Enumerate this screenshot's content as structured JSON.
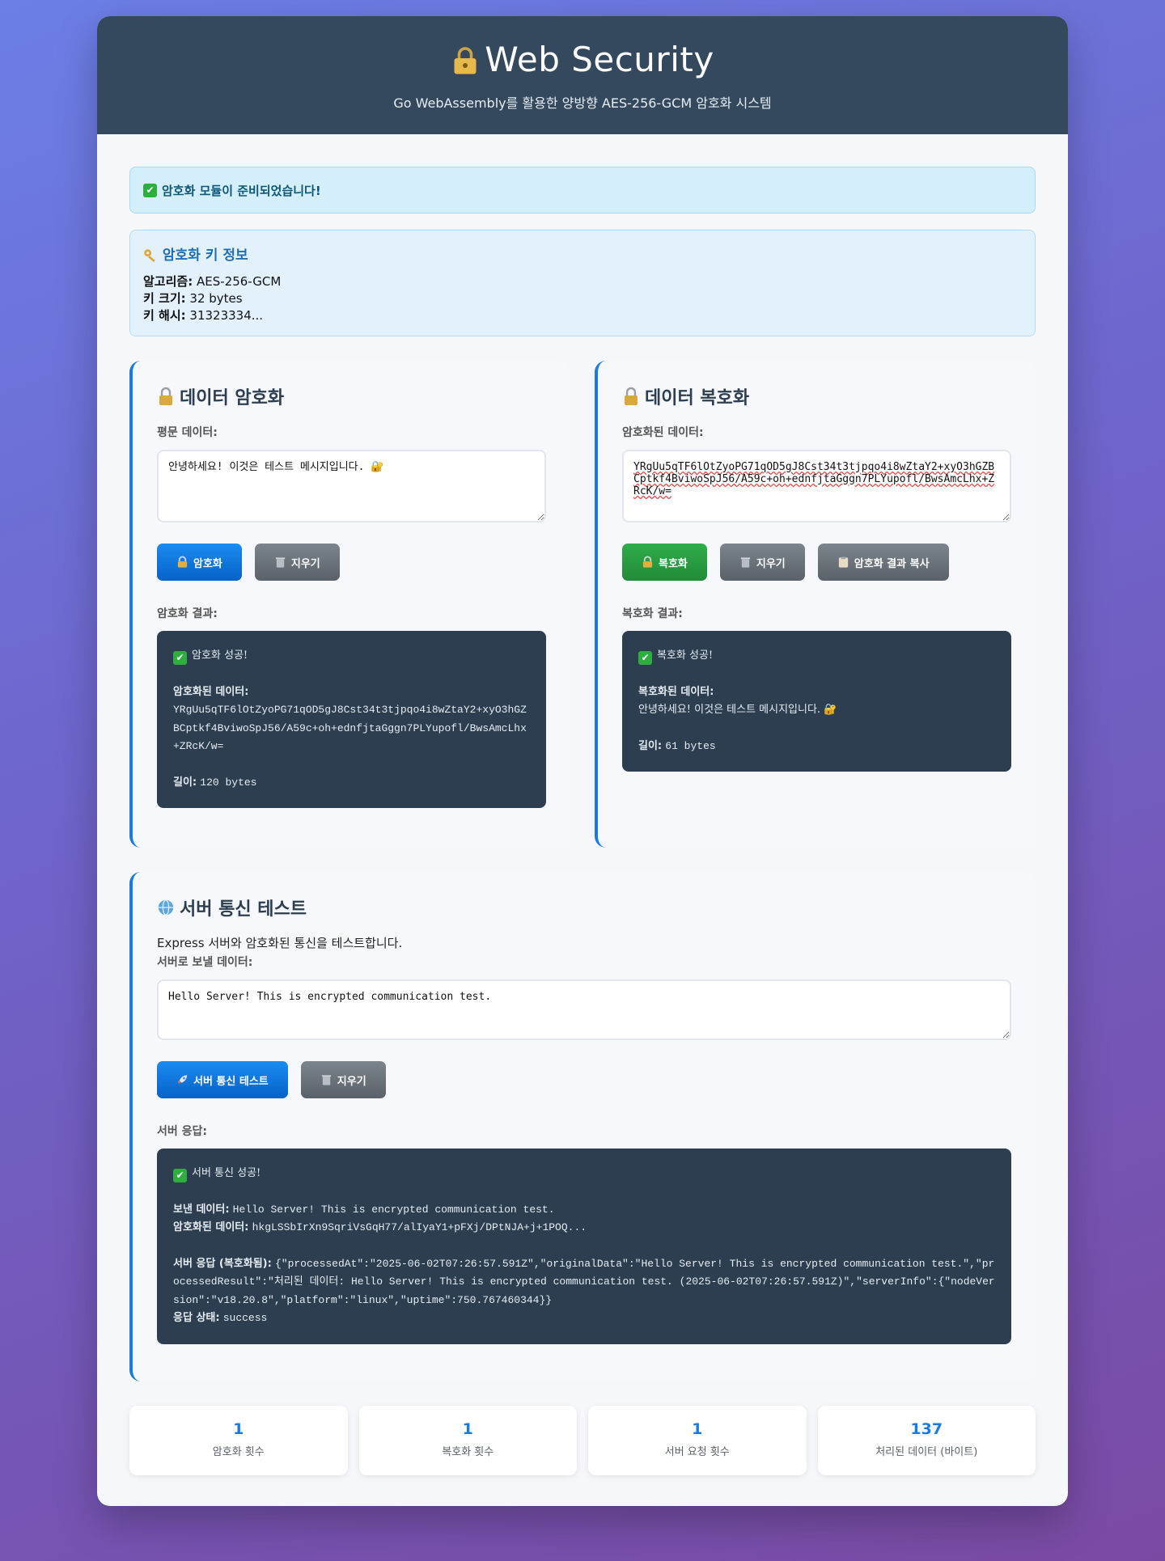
{
  "header": {
    "title": "Web Security",
    "subtitle": "Go WebAssembly를 활용한 양방향 AES-256-GCM 암호화 시스템"
  },
  "status": {
    "text": "암호화 모듈이 준비되었습니다!"
  },
  "keyinfo": {
    "title": "암호화 키 정보",
    "algorithm_label": "알고리즘:",
    "algorithm": "AES-256-GCM",
    "keysize_label": "키 크기:",
    "keysize": "32 bytes",
    "hash_label": "키 해시:",
    "hash": "31323334..."
  },
  "encrypt": {
    "title": "데이터 암호화",
    "input_label": "평문 데이터:",
    "input_value": "안녕하세요! 이것은 테스트 메시지입니다. 🔐",
    "btn_encrypt": "암호화",
    "btn_clear": "지우기",
    "result_label": "암호화 결과:",
    "result_status": "암호화 성공!",
    "result_data_label": "암호화된 데이터:",
    "result_data": "YRgUu5qTF6lOtZyoPG71qOD5gJ8Cst34t3tjpqo4i8wZtaY2+xyO3hGZBCptkf4BviwoSpJ56/A59c+oh+ednfjtaGggn7PLYupofl/BwsAmcLhx+ZRcK/w=",
    "result_len_label": "길이:",
    "result_len": "120 bytes"
  },
  "decrypt": {
    "title": "데이터 복호화",
    "input_label": "암호화된 데이터:",
    "input_value": "YRgUu5qTF6lOtZyoPG71qOD5gJ8Cst34t3tjpqo4i8wZtaY2+xyO3hGZBCptkf4BviwoSpJ56/A59c+oh+ednfjtaGggn7PLYupofl/BwsAmcLhx+ZRcK/w=",
    "btn_decrypt": "복호화",
    "btn_clear": "지우기",
    "btn_copy": "암호화 결과 복사",
    "result_label": "복호화 결과:",
    "result_status": "복호화 성공!",
    "result_data_label": "복호화된 데이터:",
    "result_data": "안녕하세요! 이것은 테스트 메시지입니다. 🔐",
    "result_len_label": "길이:",
    "result_len": "61 bytes"
  },
  "server": {
    "title": "서버 통신 테스트",
    "desc": "Express 서버와 암호화된 통신을 테스트합니다.",
    "input_label": "서버로 보낼 데이터:",
    "input_value": "Hello Server! This is encrypted communication test.",
    "btn_test": "서버 통신 테스트",
    "btn_clear": "지우기",
    "result_label": "서버 응답:",
    "result_status": "서버 통신 성공!",
    "sent_label": "보낸 데이터:",
    "sent": "Hello Server! This is encrypted communication test.",
    "enc_label": "암호화된 데이터:",
    "enc": "hkgLSSbIrXn9SqriVsGqH77/alIyaY1+pFXj/DPtNJA+j+1POQ...",
    "resp_label": "서버 응답 (복호화됨):",
    "resp": "{\"processedAt\":\"2025-06-02T07:26:57.591Z\",\"originalData\":\"Hello Server! This is encrypted communication test.\",\"processedResult\":\"처리된 데이터: Hello Server! This is encrypted communication test. (2025-06-02T07:26:57.591Z)\",\"serverInfo\":{\"nodeVersion\":\"v18.20.8\",\"platform\":\"linux\",\"uptime\":750.767460344}}",
    "state_label": "응답 상태:",
    "state": "success"
  },
  "stats": [
    {
      "value": "1",
      "label": "암호화 횟수"
    },
    {
      "value": "1",
      "label": "복호화 횟수"
    },
    {
      "value": "1",
      "label": "서버 요청 횟수"
    },
    {
      "value": "137",
      "label": "처리된 데이터 (바이트)"
    }
  ],
  "icons": {
    "header": "lock-key-icon",
    "status": "check-icon",
    "keyinfo": "key-icon",
    "encrypt": "lock-icon",
    "decrypt": "lock-icon",
    "server": "globe-icon",
    "clear": "trash-icon",
    "copy": "clipboard-icon",
    "test": "rocket-icon"
  },
  "colors": {
    "accent": "#1a7ae0",
    "header_bg": "#34495e",
    "result_bg": "#2c3e50",
    "success": "#2eae3f"
  }
}
